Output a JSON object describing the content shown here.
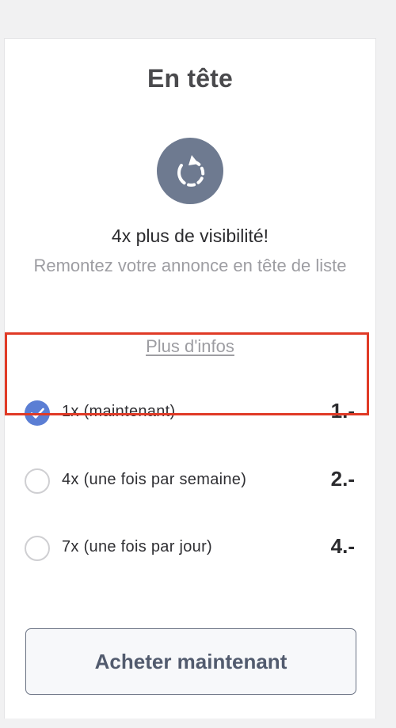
{
  "card": {
    "title": "En tête",
    "icon": "refresh-up-arrow-icon",
    "headline": "4x plus de visibilité!",
    "subtext": "Remontez votre annonce en tête de liste",
    "more_info": "Plus d'infos"
  },
  "options": [
    {
      "label": "1x (maintenant)",
      "price": "1.-",
      "selected": true
    },
    {
      "label": "4x (une fois par semaine)",
      "price": "2.-",
      "selected": false
    },
    {
      "label": "7x (une fois par jour)",
      "price": "4.-",
      "selected": false
    }
  ],
  "buy_button": {
    "label": "Acheter maintenant"
  },
  "colors": {
    "icon_bg": "#6e7a90",
    "radio_selected": "#5b7ed4",
    "highlight_border": "#e03a26",
    "button_text": "#525b6e"
  }
}
